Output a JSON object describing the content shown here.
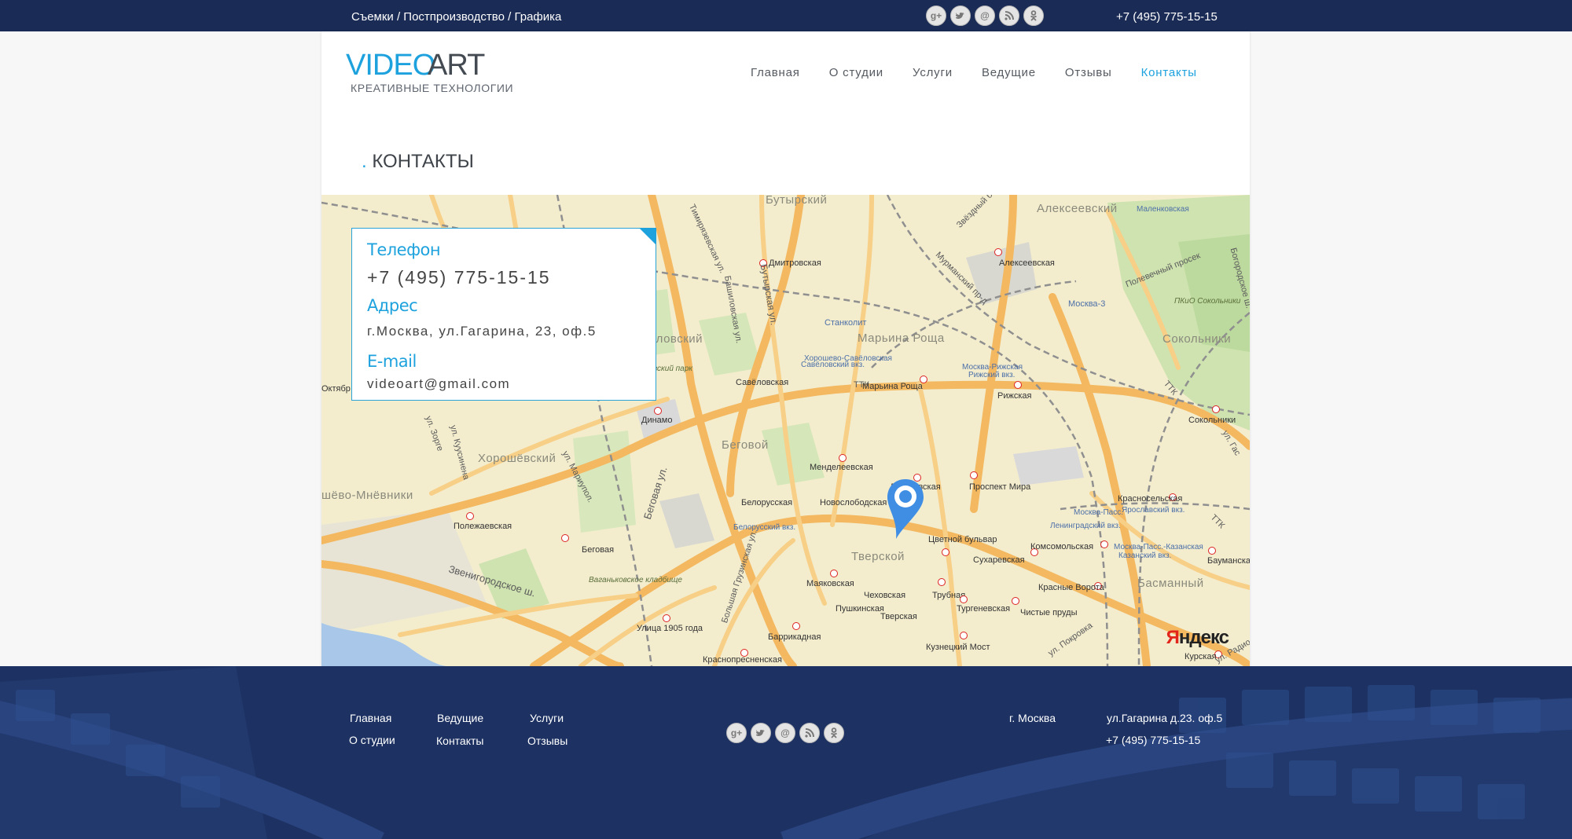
{
  "topbar": {
    "tagline": "Съемки / Постпроизводство / Графика",
    "phone": "+7 (495) 775-15-15",
    "social": [
      "google-plus-icon",
      "twitter-icon",
      "mail-icon",
      "rss-icon",
      "odnoklassniki-icon"
    ]
  },
  "logo": {
    "word1": "VIDEO",
    "word2": "ART",
    "subtitle": "КРЕАТИВНЫЕ ТЕХНОЛОГИИ"
  },
  "nav": {
    "items": [
      "Главная",
      "О студии",
      "Услуги",
      "Ведущие",
      "Отзывы",
      "Контакты"
    ],
    "active": "Контакты"
  },
  "page": {
    "title_dot": ".",
    "title": "КОНТАКТЫ"
  },
  "contact_card": {
    "phone_heading": "Телефон",
    "phone": "+7 (495) 775-15-15",
    "address_heading": "Адрес",
    "address": "г.Москва, ул.Гагарина, 23, оф.5",
    "email_heading": "E-mail",
    "email": "videoart@gmail.com"
  },
  "map": {
    "provider": "Яндекс",
    "districts": [
      "Бутырский",
      "Алексеевский",
      "Савёловский",
      "Марьина Роща",
      "Сокольники",
      "Беговой",
      "Хорошёвский",
      "Тверской",
      "Басманный",
      "шёво-Мнёвники"
    ],
    "stations": [
      "Дмитровская",
      "Алексеевская",
      "Савёловская",
      "Марьина Роща",
      "Рижская",
      "Динамо",
      "Сокольники",
      "Менделеевская",
      "Достоевская",
      "Проспект Мира",
      "Новослободская",
      "Белорусская",
      "Полежаевская",
      "Беговая",
      "Цветной бульвар",
      "Сухаревская",
      "Комсомольская",
      "Красносельская",
      "Маяковская",
      "Чеховская",
      "Трубная",
      "Тургеневская",
      "Чистые пруды",
      "Красные Ворота",
      "Бауманская",
      "Пушкинская",
      "Тверская",
      "Баррикадная",
      "Кузнецкий Мост",
      "Улица 1905 года",
      "Краснопресненская",
      "Курская",
      "Станколит",
      "Москва-3",
      "Октябр"
    ],
    "streets": [
      "ТТК",
      "Звенигородское ш.",
      "Беговая ул.",
      "ул. Куусинена",
      "ул. Зорге",
      "ул. Мариупол.",
      "Бутырская ул.",
      "Башиловская ул.",
      "Тимирязевская ул.",
      "Мурманский пр-д",
      "Большая Грузинская ул.",
      "ул. Покровка",
      "Звёздный б-р",
      "Полевечный просек",
      "Богородское ш.",
      "ул. Радио",
      "ул. Гас"
    ],
    "places": [
      "Ваганьковское кладбище",
      "Петровский парк",
      "ПКиО Сокольники",
      "Савёловский вкз.",
      "Рижский вкз.",
      "Белорусский вкз.",
      "Москва-Пасс.",
      "Ярославский вкз.",
      "Ленинградский вкз.",
      "Москва-Пасс.-Казанская",
      "Казанский вкз.",
      "Москва-Рижская",
      "Маленковская",
      "Хорошево-Савёловская"
    ]
  },
  "footer": {
    "links": [
      [
        "Главная",
        "Ведущие",
        "Услуги"
      ],
      [
        "О студии",
        "Контакты",
        "Отзывы"
      ]
    ],
    "city": "г. Москва",
    "address": "ул.Гагарина д.23. оф.5",
    "phone": "+7 (495) 775-15-15"
  }
}
